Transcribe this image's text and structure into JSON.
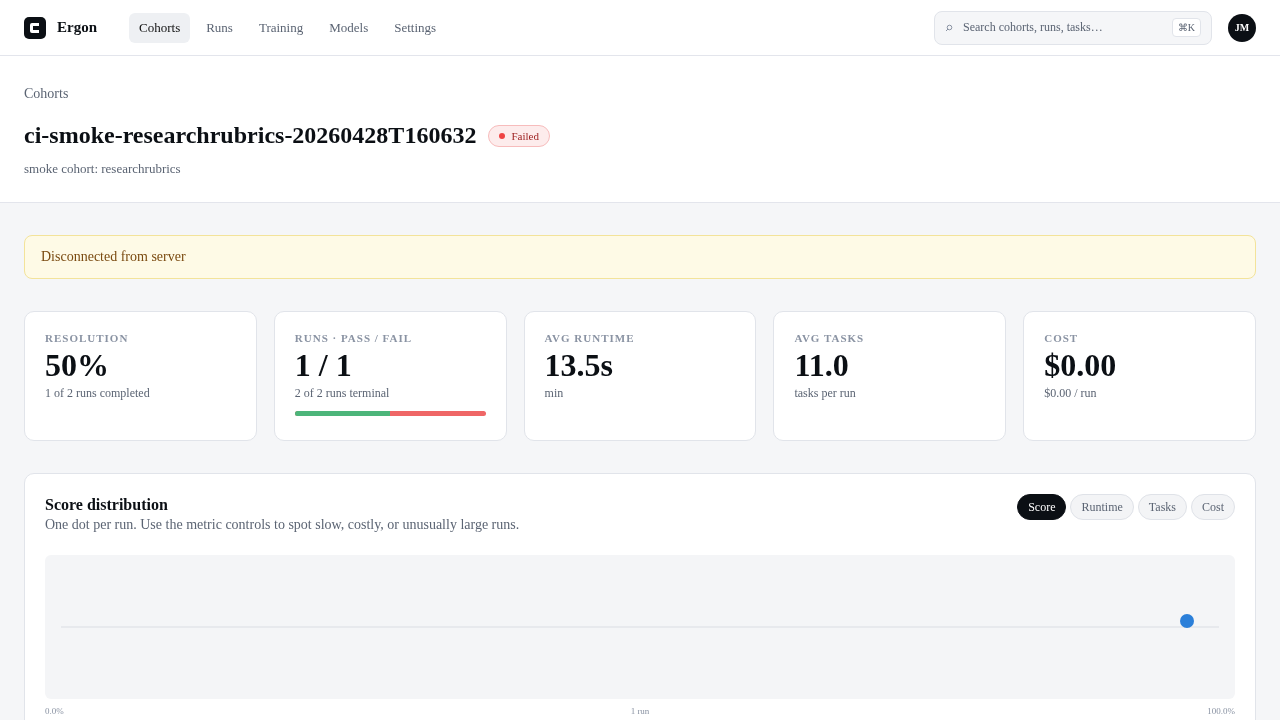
{
  "app": {
    "name": "Ergon"
  },
  "nav": [
    {
      "label": "Cohorts",
      "selected": true
    },
    {
      "label": "Runs",
      "selected": false
    },
    {
      "label": "Training",
      "selected": false
    },
    {
      "label": "Models",
      "selected": false
    },
    {
      "label": "Settings",
      "selected": false
    }
  ],
  "search": {
    "placeholder": "Search cohorts, runs, tasks…",
    "shortcut": "⌘K"
  },
  "user": {
    "initials": "JM"
  },
  "breadcrumb": "Cohorts",
  "title": "ci-smoke-researchrubrics-20260428T160632",
  "status": {
    "label": "Failed",
    "color": "#ef4444"
  },
  "subtitle": "smoke cohort: researchrubrics",
  "alert": "Disconnected from server",
  "stats": [
    {
      "label": "RESOLUTION",
      "value": "50%",
      "sub": "1 of 2 runs completed"
    },
    {
      "label": "RUNS · PASS / FAIL",
      "value": "1 / 1",
      "sub": "2 of 2 runs terminal",
      "bar": {
        "level": 0.5
      }
    },
    {
      "label": "AVG RUNTIME",
      "value": "13.5s",
      "sub": "min"
    },
    {
      "label": "AVG TASKS",
      "value": "11.0",
      "sub": "tasks per run"
    },
    {
      "label": "COST",
      "value": "$0.00",
      "sub": "$0.00 / run"
    }
  ],
  "distribution": {
    "title": "Score distribution",
    "description": "One dot per run. Use the metric controls to spot slow, costly, or unusually large runs.",
    "metrics": [
      {
        "label": "Score",
        "selected": true
      },
      {
        "label": "Runtime",
        "selected": false
      },
      {
        "label": "Tasks",
        "selected": false
      },
      {
        "label": "Cost",
        "selected": false
      }
    ],
    "axis_labels": [
      "0.0%",
      "1 run",
      "100.0%"
    ]
  }
}
